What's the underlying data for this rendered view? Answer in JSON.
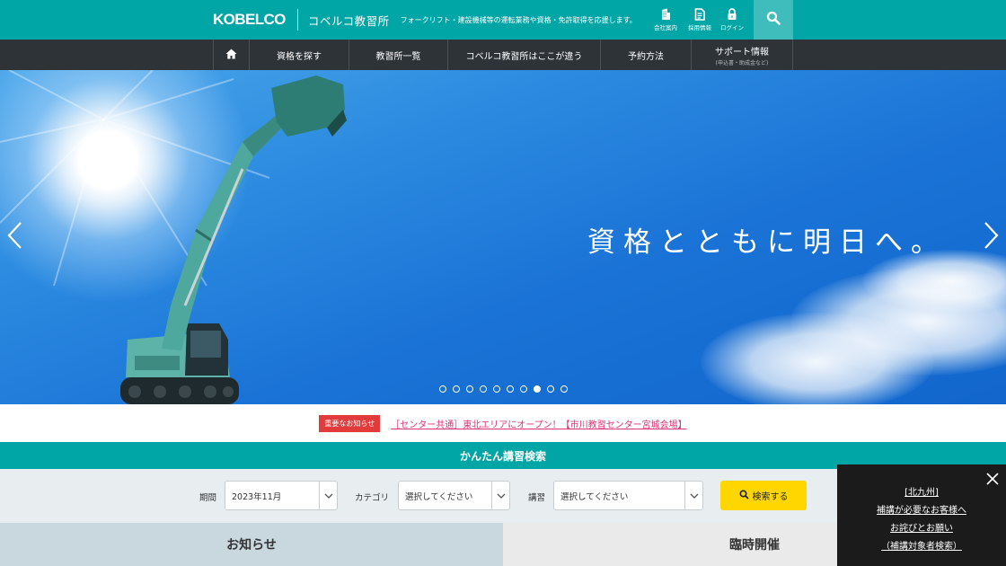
{
  "header": {
    "logo": "KOBELCO",
    "school_name": "コベルコ教習所",
    "tagline": "フォークリフト・建設機械等の運転業務や資格・免許取得を応援します。",
    "utility_links": [
      {
        "label": "会社案内",
        "icon": "building-icon"
      },
      {
        "label": "採用情報",
        "icon": "document-icon"
      },
      {
        "label": "ログイン",
        "icon": "lock-icon"
      }
    ],
    "search_icon": "search-icon"
  },
  "nav": {
    "home_icon": "home-icon",
    "items": [
      {
        "label": "資格を探す",
        "sub": ""
      },
      {
        "label": "教習所一覧",
        "sub": ""
      },
      {
        "label": "コベルコ教習所はここが違う",
        "sub": ""
      },
      {
        "label": "予約方法",
        "sub": ""
      },
      {
        "label": "サポート情報",
        "sub": "(申込書・助成金など)"
      }
    ]
  },
  "hero": {
    "headline": "資格とともに明日へ。",
    "slide_count": 10,
    "active_slide": 8,
    "prev_icon": "chevron-left-icon",
    "next_icon": "chevron-right-icon"
  },
  "notice": {
    "badge": "重要なお知らせ",
    "link_text": "［センター共通］東北エリアにオープン！【市川教習センター宮城会場】"
  },
  "search": {
    "title": "かんたん講習検索",
    "period_label": "期間",
    "period_value": "2023年11月",
    "category_label": "カテゴリ",
    "category_value": "選択してください",
    "course_label": "講習",
    "course_value": "選択してください",
    "button_label": "検索する"
  },
  "tabs": {
    "news": "お知らせ",
    "extra": "臨時開催"
  },
  "popup": {
    "lines": [
      "[北九州]",
      "補講が必要なお客様へ",
      "お詫びとお願い",
      "（補講対象者検索）"
    ]
  },
  "colors": {
    "teal": "#00a6a6",
    "nav_dark": "#2e3338",
    "notice_red": "#e23b3b",
    "notice_link": "#e0317a",
    "search_button": "#ffd600"
  }
}
